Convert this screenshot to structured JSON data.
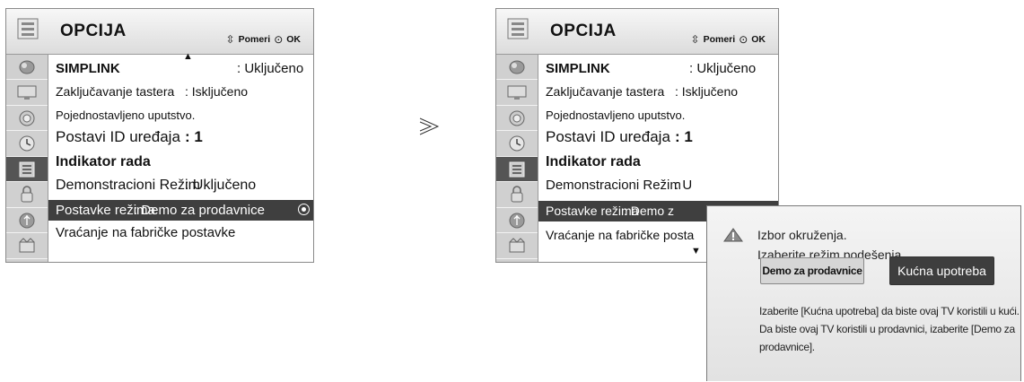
{
  "menu": {
    "title": "OPCIJA",
    "nav_move": "Pomeri",
    "nav_ok": "OK",
    "sidebar_icons": [
      "satellite-icon",
      "monitor-icon",
      "speaker-icon",
      "clock-icon",
      "options-icon",
      "lock-icon",
      "usb-icon",
      "media-icon"
    ],
    "active_sidebar_index": 4
  },
  "left_menu": {
    "items": [
      {
        "label": "SIMPLINK",
        "value": ": Uključeno"
      },
      {
        "label": "Zaključavanje tastera",
        "value": ": Isključeno"
      },
      {
        "label": "Pojednostavljeno uputstvo.",
        "value": ""
      },
      {
        "label": "Postavi ID uređaja",
        "value": ": 1"
      },
      {
        "label": "Indikator rada",
        "value": ""
      },
      {
        "label": "Demonstracioni Režim",
        "value": ": Uključeno"
      },
      {
        "label": "Postavke režima",
        "value": ": Demo za prodavnice"
      },
      {
        "label": "Vraćanje na fabričke postavke",
        "value": ""
      }
    ],
    "selected_index": 6
  },
  "right_menu": {
    "items": [
      {
        "label": "SIMPLINK",
        "value": ": Uključeno"
      },
      {
        "label": "Zaključavanje tastera",
        "value": ": Isključeno"
      },
      {
        "label": "Pojednostavljeno uputstvo.",
        "value": ""
      },
      {
        "label": "Postavi ID uređaja",
        "value": ": 1"
      },
      {
        "label": "Indikator rada",
        "value": ""
      },
      {
        "label": "Demonstracioni Režim",
        "value": ": U"
      },
      {
        "label": "Postavke režima",
        "value": ": Demo z"
      },
      {
        "label": "Vraćanje na fabričke posta",
        "value": ""
      }
    ],
    "selected_index": 6
  },
  "separator": "≫",
  "popup": {
    "title": "Izbor okruženja.",
    "subtitle": "Izaberite režim podešenja.",
    "button_demo": "Demo za prodavnice",
    "button_home": "Kućna upotreba",
    "description": "Izaberite [Kućna upotreba] da biste ovaj TV koristili u kući. Da biste ovaj TV koristili u prodavnici, izaberite [Demo za prodavnice]."
  },
  "colors": {
    "selected_row": "#3f3f3f",
    "sidebar_bg": "#d0d0d0",
    "active_sidebar": "#555555"
  }
}
